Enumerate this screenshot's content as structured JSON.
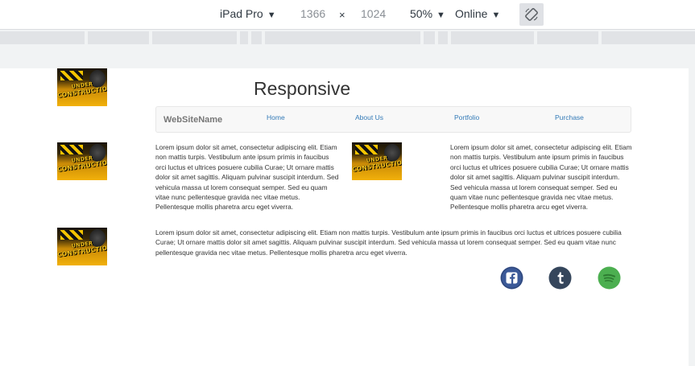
{
  "devtools": {
    "device": "iPad Pro",
    "width": "1366",
    "times": "×",
    "height": "1024",
    "zoom": "50%",
    "throttle": "Online",
    "caret": "▼"
  },
  "page": {
    "title": "Responsive",
    "thumbnail_text": {
      "line1": "UNDER",
      "line2": "CONSTRUCTION"
    },
    "navbar": {
      "brand": "WebSiteName",
      "links": [
        "Home",
        "About Us",
        "Portfolio",
        "Purchase"
      ]
    },
    "paragraphs": [
      "Lorem ipsum dolor sit amet, consectetur adipiscing elit. Etiam non mattis turpis. Vestibulum ante ipsum primis in faucibus orci luctus et ultrices posuere cubilia Curae; Ut ornare mattis dolor sit amet sagittis. Aliquam pulvinar suscipit interdum. Sed vehicula massa ut lorem consequat semper. Sed eu quam vitae nunc pellentesque gravida nec vitae metus. Pellentesque mollis pharetra arcu eget viverra.",
      "Lorem ipsum dolor sit amet, consectetur adipiscing elit. Etiam non mattis turpis. Vestibulum ante ipsum primis in faucibus orci luctus et ultrices posuere cubilia Curae; Ut ornare mattis dolor sit amet sagittis. Aliquam pulvinar suscipit interdum. Sed vehicula massa ut lorem consequat semper. Sed eu quam vitae nunc pellentesque gravida nec vitae metus. Pellentesque mollis pharetra arcu eget viverra.",
      "Lorem ipsum dolor sit amet, consectetur adipiscing elit. Etiam non mattis turpis. Vestibulum ante ipsum primis in faucibus orci luctus et ultrices posuere cubilia Curae; Ut ornare mattis dolor sit amet sagittis. Aliquam pulvinar suscipit interdum. Sed vehicula massa ut lorem consequat semper. Sed eu quam vitae nunc pellentesque gravida nec vitae metus. Pellentesque mollis pharetra arcu eget viverra."
    ],
    "social": [
      {
        "icon": "facebook-icon",
        "glyph": "f",
        "color": "#3b5998"
      },
      {
        "icon": "tumblr-icon",
        "glyph": "t",
        "color": "#35465c"
      },
      {
        "icon": "spotify-icon",
        "glyph": "",
        "color": "#4caf50"
      }
    ]
  }
}
